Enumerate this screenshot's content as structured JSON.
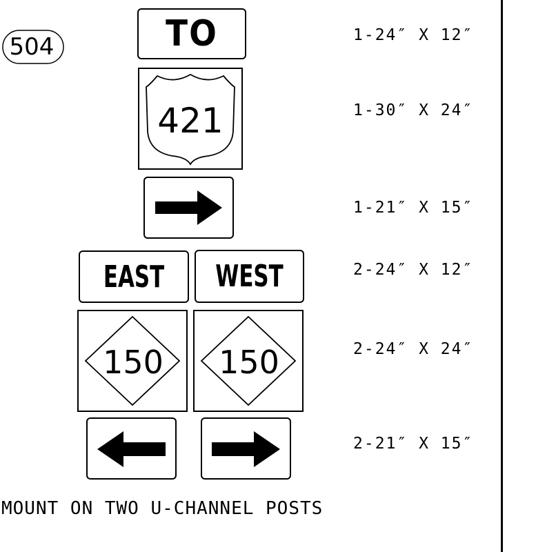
{
  "callout": {
    "number": "504"
  },
  "signs": {
    "to_plaque": {
      "text": "TO"
    },
    "us_shield": {
      "route": "421"
    },
    "arrow_single": {
      "direction": "right"
    },
    "east_plaque": {
      "text": "EAST"
    },
    "west_plaque": {
      "text": "WEST"
    },
    "nc_marker_left": {
      "route": "150"
    },
    "nc_marker_right": {
      "route": "150"
    },
    "arrow_left": {
      "direction": "left"
    },
    "arrow_right": {
      "direction": "right"
    }
  },
  "sizes": [
    {
      "label": "1-24″ X 12″"
    },
    {
      "label": "1-30″ X 24″"
    },
    {
      "label": "1-21″ X 15″"
    },
    {
      "label": "2-24″ X 12″"
    },
    {
      "label": "2-24″ X 24″"
    },
    {
      "label": "2-21″ X 15″"
    }
  ],
  "note": "MOUNT ON TWO U-CHANNEL POSTS",
  "colors": {
    "ink": "#000000",
    "background": "#ffffff"
  }
}
